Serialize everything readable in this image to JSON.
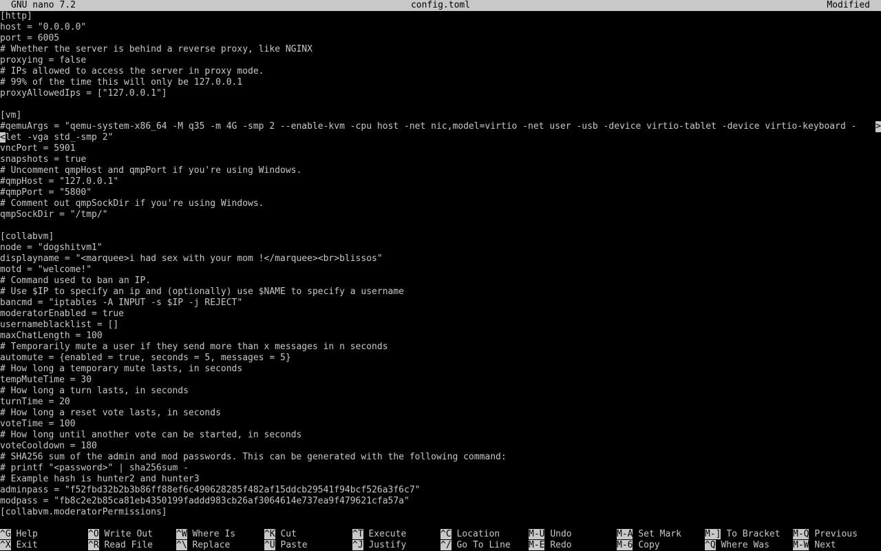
{
  "titlebar": {
    "app": "GNU nano 7.2",
    "filename": "config.toml",
    "status": "Modified"
  },
  "editor": {
    "lines": [
      "[http]",
      "host = \"0.0.0.0\"",
      "port = 6005",
      "# Whether the server is behind a reverse proxy, like NGINX",
      "proxying = false",
      "# IPs allowed to access the server in proxy mode.",
      "# 99% of the time this will only be 127.0.0.1",
      "proxyAllowedIps = [\"127.0.0.1\"]",
      "",
      "[vm]",
      "#qemuArgs = \"qemu-system-x86_64 -M q35 -m 4G -smp 2 --enable-kvm -cpu host -net nic,model=virtio -net user -usb -device virtio-tablet -device virtio-keyboard -",
      "let -vga std_-smp 2\"",
      "vncPort = 5901",
      "snapshots = true",
      "# Uncomment qmpHost and qmpPort if you're using Windows.",
      "#qmpHost = \"127.0.0.1\"",
      "#qmpPort = \"5800\"",
      "# Comment out qmpSockDir if you're using Windows.",
      "qmpSockDir = \"/tmp/\"",
      "",
      "[collabvm]",
      "node = \"dogshitvm1\"",
      "displayname = \"<marquee>i had sex with your mom !</marquee><br>blissos\"",
      "motd = \"welcome!\"",
      "# Command used to ban an IP.",
      "# Use $IP to specify an ip and (optionally) use $NAME to specify a username",
      "bancmd = \"iptables -A INPUT -s $IP -j REJECT\"",
      "moderatorEnabled = true",
      "usernameblacklist = []",
      "maxChatLength = 100",
      "# Temporarily mute a user if they send more than x messages in n seconds",
      "automute = {enabled = true, seconds = 5, messages = 5}",
      "# How long a temporary mute lasts, in seconds",
      "tempMuteTime = 30",
      "# How long a turn lasts, in seconds",
      "turnTime = 20",
      "# How long a reset vote lasts, in seconds",
      "voteTime = 100",
      "# How long until another vote can be started, in seconds",
      "voteCooldown = 180",
      "# SHA256 sum of the admin and mod passwords. This can be generated with the following command:",
      "# printf \"<password>\" | sha256sum -",
      "# Example hash is hunter2 and hunter3",
      "adminpass = \"f52fbd32b2b3b86ff88ef6c490628285f482af15ddcb29541f94bcf526a3f6c7\"",
      "modpass = \"fb8c2e2b85ca81eb4350199faddd983cb26af3064614e737ea9f479621cfa57a\"",
      "[collabvm.moderatorPermissions]"
    ],
    "overflow_right_marker": ">",
    "overflow_left_marker": "<"
  },
  "help": {
    "row1": [
      {
        "key": "^G",
        "label": "Help"
      },
      {
        "key": "^O",
        "label": "Write Out"
      },
      {
        "key": "^W",
        "label": "Where Is"
      },
      {
        "key": "^K",
        "label": "Cut"
      },
      {
        "key": "^T",
        "label": "Execute"
      },
      {
        "key": "^C",
        "label": "Location"
      },
      {
        "key": "M-U",
        "label": "Undo"
      },
      {
        "key": "M-A",
        "label": "Set Mark"
      },
      {
        "key": "M-]",
        "label": "To Bracket"
      },
      {
        "key": "M-Q",
        "label": "Previous"
      }
    ],
    "row2": [
      {
        "key": "^X",
        "label": "Exit"
      },
      {
        "key": "^R",
        "label": "Read File"
      },
      {
        "key": "^\\",
        "label": "Replace"
      },
      {
        "key": "^U",
        "label": "Paste"
      },
      {
        "key": "^J",
        "label": "Justify"
      },
      {
        "key": "^/",
        "label": "Go To Line"
      },
      {
        "key": "M-E",
        "label": "Redo"
      },
      {
        "key": "M-6",
        "label": "Copy"
      },
      {
        "key": "^Q",
        "label": "Where Was"
      },
      {
        "key": "M-W",
        "label": "Next"
      }
    ]
  },
  "colors": {
    "background": "#000000",
    "foreground": "#c8c8c8",
    "inverse_bg": "#c8c8c8",
    "inverse_fg": "#000000"
  }
}
